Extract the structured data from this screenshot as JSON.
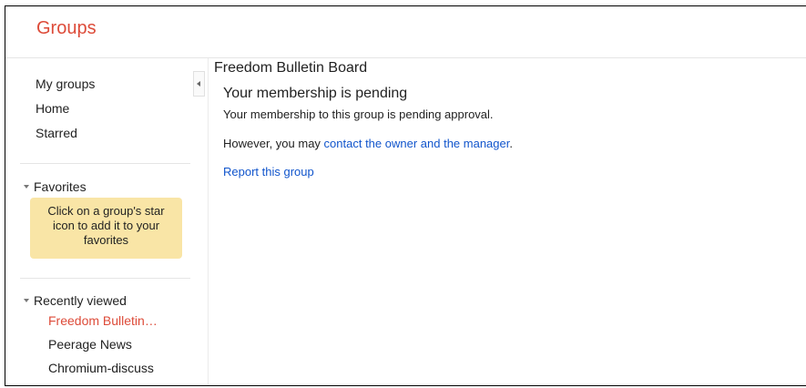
{
  "header": {
    "app_title": "Groups"
  },
  "sidebar": {
    "nav": [
      {
        "label": "My groups"
      },
      {
        "label": "Home"
      },
      {
        "label": "Starred"
      }
    ],
    "favorites": {
      "label": "Favorites",
      "hint": "Click on a group's star icon to add it to your favorites"
    },
    "recently_viewed": {
      "label": "Recently viewed",
      "items": [
        {
          "label": "Freedom Bulletin…",
          "active": true
        },
        {
          "label": "Peerage News",
          "active": false
        },
        {
          "label": "Chromium-discuss",
          "active": false
        }
      ]
    }
  },
  "main": {
    "group_title": "Freedom Bulletin Board",
    "pending_heading": "Your membership is pending",
    "pending_text": "Your membership to this group is pending approval.",
    "contact_prefix": "However, you may ",
    "contact_link": "contact the owner and the manager",
    "contact_suffix": ".",
    "report_link": "Report this group"
  },
  "colors": {
    "brand": "#dd4b39",
    "link": "#1155cc",
    "hint_bg": "#f9e5a6"
  },
  "icons": {
    "collapse": "chevron-left-icon",
    "section_toggle": "triangle-down-icon"
  }
}
